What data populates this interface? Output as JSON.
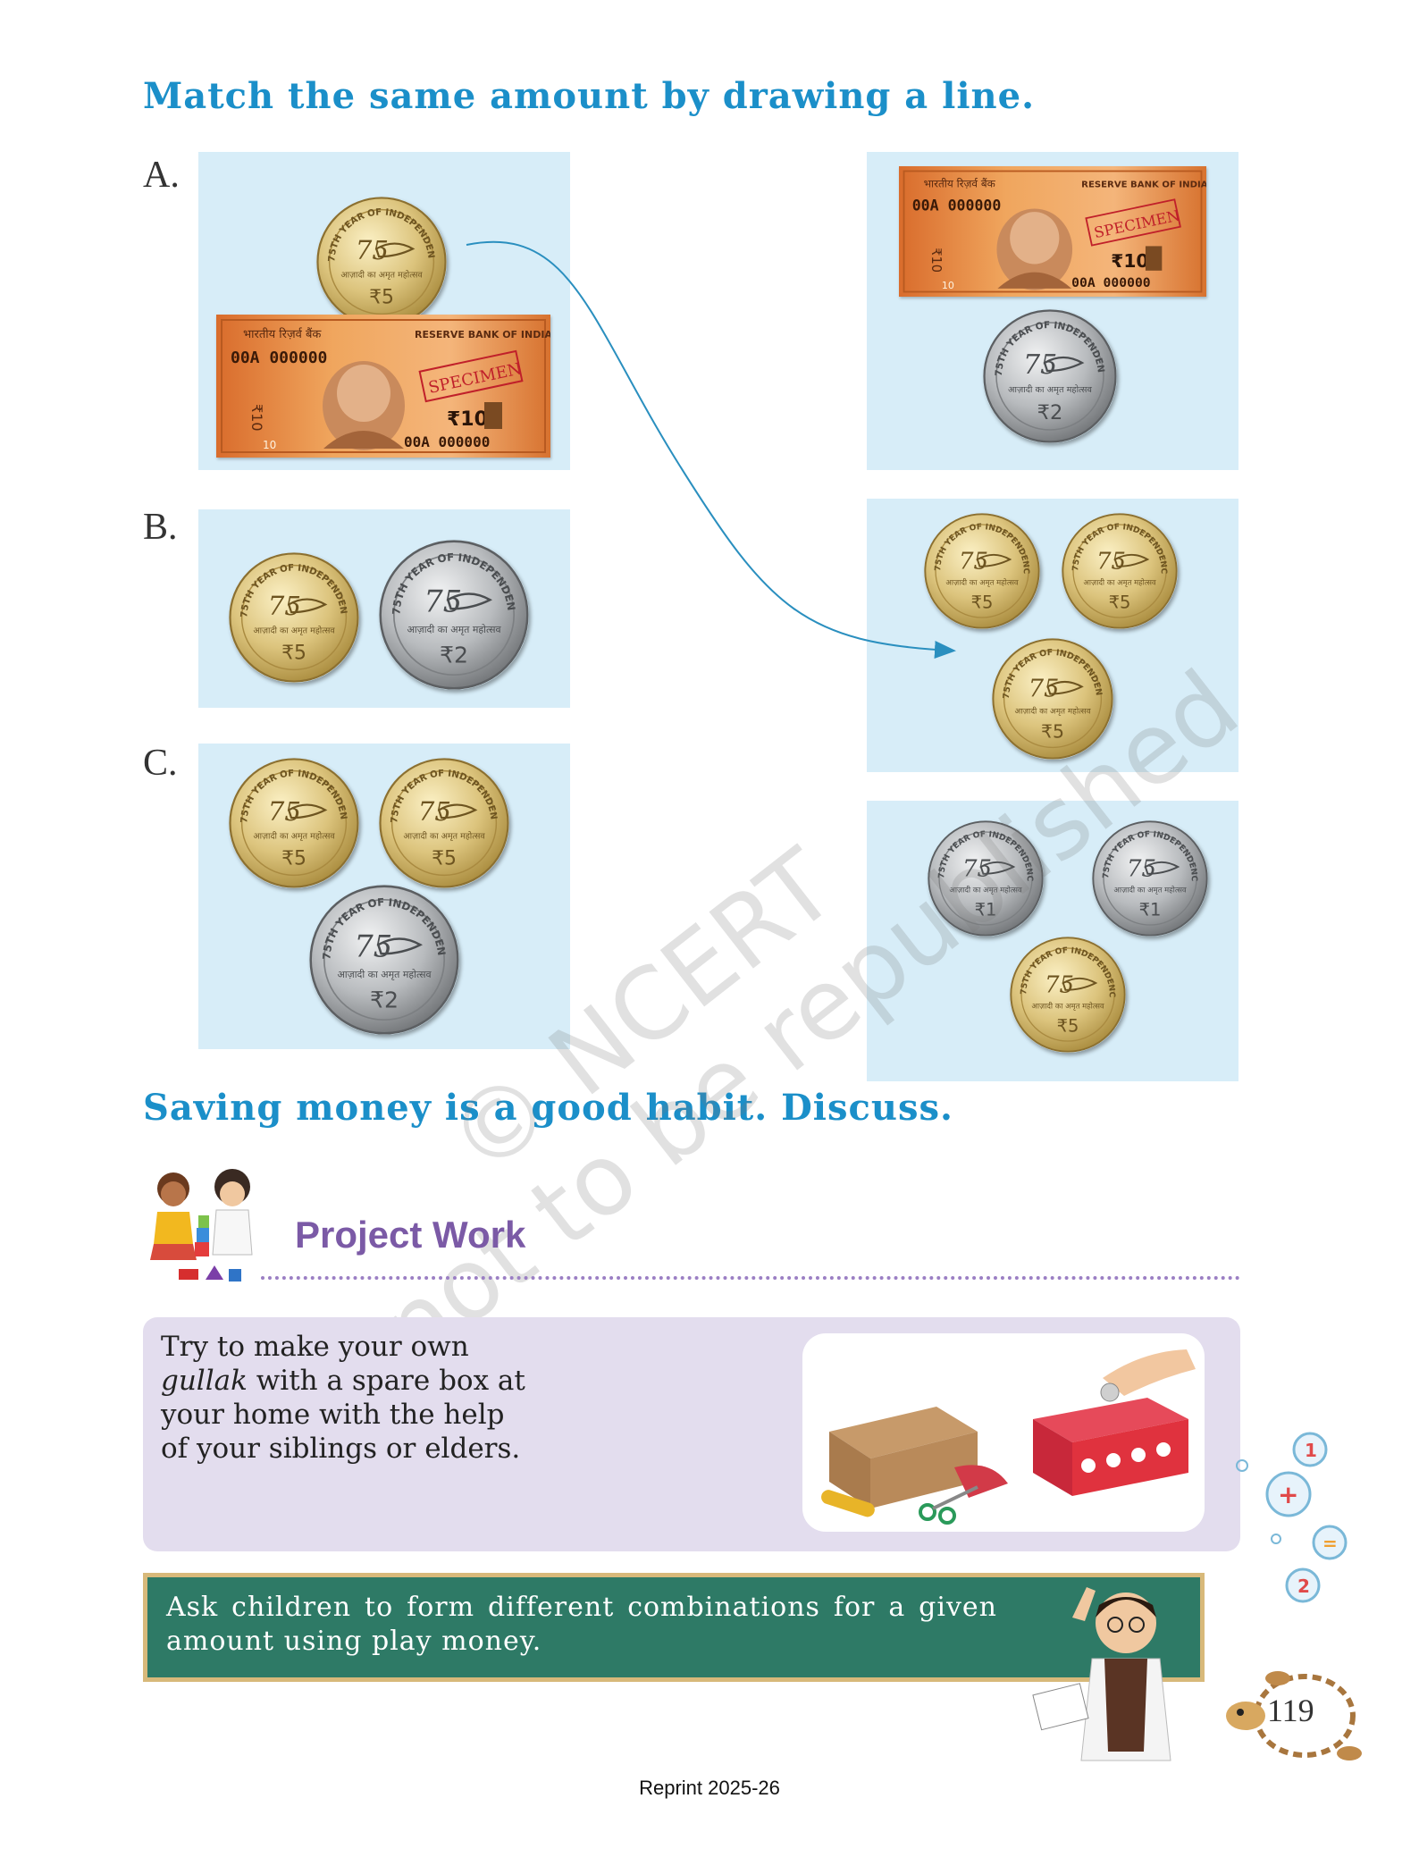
{
  "heading_match": "Match the same amount by drawing a line.",
  "labels": {
    "a": "A.",
    "b": "B.",
    "c": "C."
  },
  "coin_text": {
    "five": "₹5",
    "two": "₹2",
    "one": "₹1",
    "rim": "75TH YEAR OF INDEPENDENCE",
    "hindi": "आज़ादी का अमृत महोत्सव"
  },
  "note": {
    "value": "₹10",
    "serial": "00A 000000",
    "bank_hindi": "भारतीय रिज़र्व बैंक",
    "bank": "RESERVE BANK OF INDIA",
    "specimen": "SPECIMEN",
    "side_value": "₹10",
    "corner": "10"
  },
  "heading_saving": "Saving money is a good habit. Discuss.",
  "watermark": {
    "line1": "© NCERT",
    "line2": "not to be republished"
  },
  "project": {
    "title": "Project Work",
    "text_1": "Try to make your own",
    "text_2_italic": "gullak",
    "text_2_rest": " with a spare box at",
    "text_3": "your home with the help",
    "text_4": "of your siblings or elders."
  },
  "teacher_note": "Ask children to form different combinations for a given amount using play money.",
  "page_number": "119",
  "reprint": "Reprint 2025-26",
  "colors": {
    "heading": "#1b8fc9",
    "panel": "#d7edf8",
    "project_title": "#7b5aa6",
    "project_box": "#e3ddee",
    "board": "#2e7a66",
    "gold_coin": "#d9c27a",
    "silver_coin": "#b9bcbf",
    "note": "#e6914a",
    "arrow": "#2a8fbf"
  }
}
